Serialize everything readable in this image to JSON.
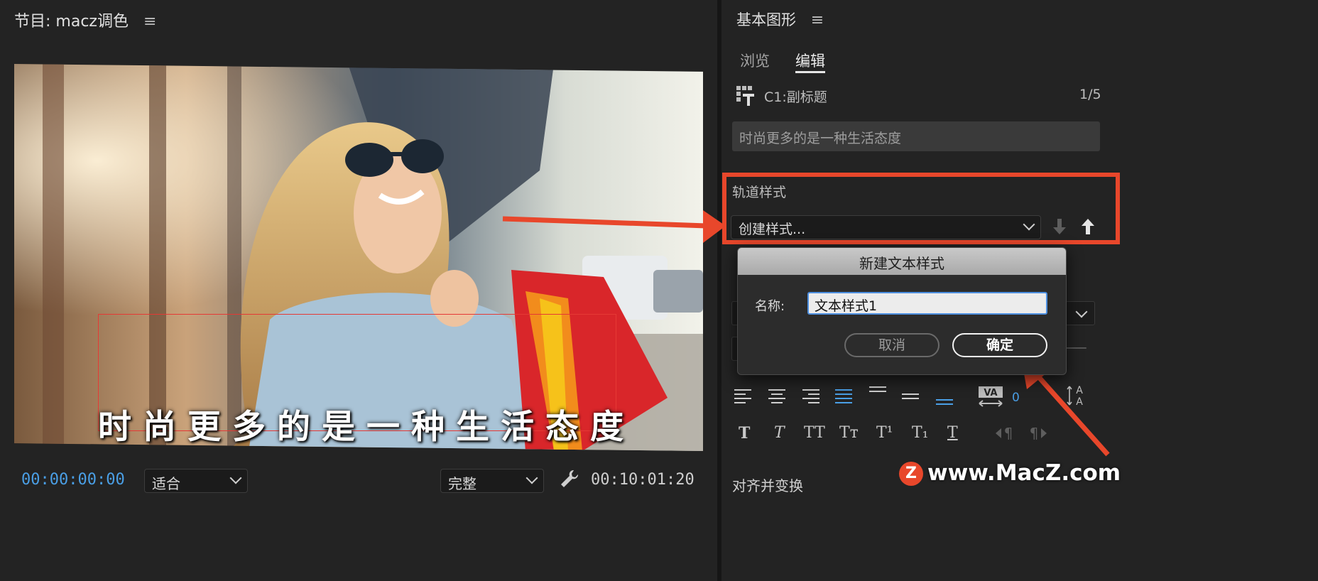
{
  "program_monitor": {
    "title": "节目: macz调色",
    "menu_glyph": "≡",
    "caption": "时尚更多的是一种生活态度",
    "timecode_current": "00:00:00:00",
    "fit_select": "适合",
    "quality_select": "完整",
    "timecode_duration": "00:10:01:20"
  },
  "essential_graphics": {
    "title": "基本图形",
    "menu_glyph": "≡",
    "tabs": {
      "browse": "浏览",
      "edit": "编辑"
    },
    "layer_name": "C1:副标题",
    "layer_count": "1/5",
    "text_field_value": "时尚更多的是一种生活态度",
    "track_style_label": "轨道样式",
    "style_select_value": "创建样式...",
    "tracking_value": "0",
    "text_style_buttons": [
      "T",
      "T",
      "TT",
      "Tт",
      "T¹",
      "T₁",
      "T"
    ],
    "align_transform_label": "对齐并变换"
  },
  "dialog": {
    "title": "新建文本样式",
    "name_label": "名称:",
    "name_value": "文本样式1",
    "cancel": "取消",
    "ok": "确定"
  },
  "watermark": {
    "logo": "Z",
    "text": "www.MacZ.com"
  },
  "colors": {
    "accent_blue": "#4a9fe6",
    "annotation_red": "#e8472b",
    "panel_bg": "#232323"
  }
}
